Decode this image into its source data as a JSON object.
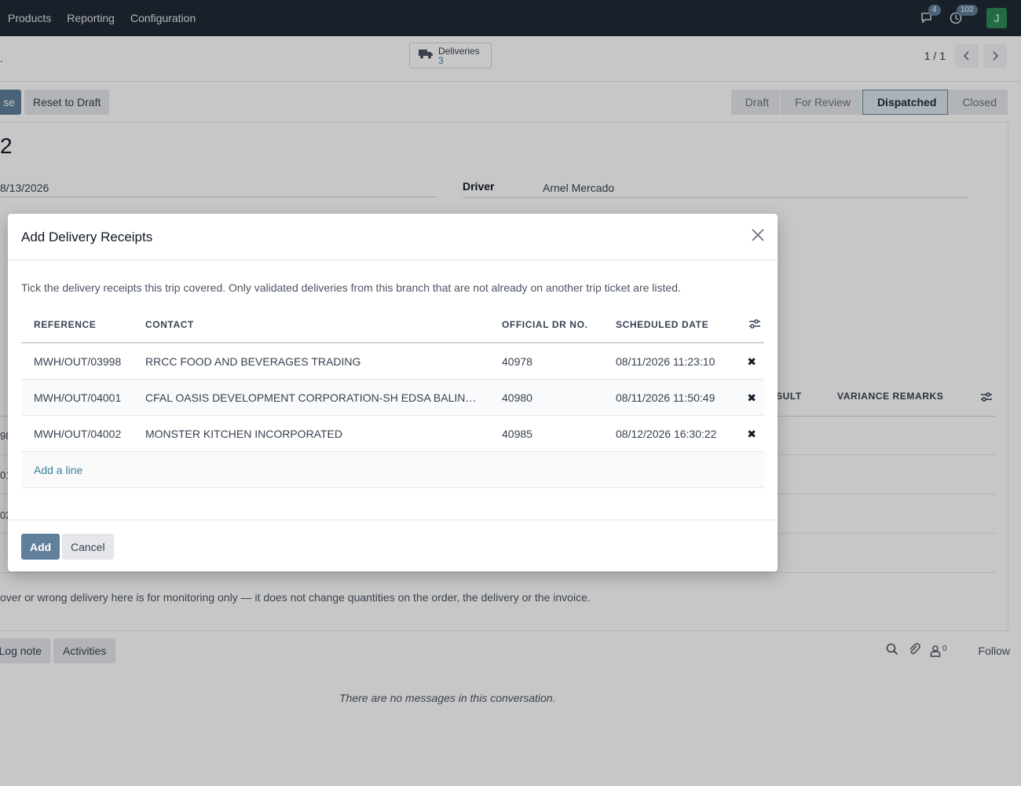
{
  "navbar": {
    "menu": [
      "Products",
      "Reporting",
      "Configuration"
    ],
    "messages_count": "4",
    "activities_count": "102",
    "avatar_initial": "J"
  },
  "control": {
    "smart_button": {
      "label": "Deliveries",
      "count": "3",
      "icon": "truck-icon"
    },
    "pager_value": "1 / 1"
  },
  "statusbar": {
    "close_label": "se",
    "reset_label": "Reset to Draft",
    "stages": [
      "Draft",
      "For Review",
      "Dispatched",
      "Closed"
    ],
    "active_stage": "Dispatched"
  },
  "form": {
    "title": "2",
    "date_value": "8/13/2026",
    "driver_label": "Driver",
    "driver_value": "Arnel Mercado",
    "background_columns": [
      "SULT",
      "VARIANCE REMARKS"
    ],
    "background_row_fragments": [
      "98",
      "01",
      "02"
    ],
    "help_text": "over or wrong delivery here is for monitoring only — it does not change quantities on the order, the delivery or the invoice."
  },
  "chatter": {
    "log_note": "Log note",
    "activities": "Activities",
    "followers_count": "0",
    "follow": "Follow",
    "empty_message": "There are no messages in this conversation."
  },
  "dialog": {
    "title": "Add Delivery Receipts",
    "description": "Tick the delivery receipts this trip covered. Only validated deliveries from this branch that are not already on another trip ticket are listed.",
    "columns": {
      "reference": "REFERENCE",
      "contact": "CONTACT",
      "official_dr": "OFFICIAL DR NO.",
      "scheduled_date": "SCHEDULED DATE"
    },
    "rows": [
      {
        "reference": "MWH/OUT/03998",
        "contact": "RRCC FOOD AND BEVERAGES TRADING",
        "official_dr": "40978",
        "scheduled_date": "08/11/2026 11:23:10"
      },
      {
        "reference": "MWH/OUT/04001",
        "contact": "CFAL OASIS DEVELOPMENT CORPORATION-SH EDSA BALINTAWAK",
        "official_dr": "40980",
        "scheduled_date": "08/11/2026 11:50:49"
      },
      {
        "reference": "MWH/OUT/04002",
        "contact": "MONSTER KITCHEN INCORPORATED",
        "official_dr": "40985",
        "scheduled_date": "08/12/2026 16:30:22"
      }
    ],
    "add_line": "Add a line",
    "add_button": "Add",
    "cancel_button": "Cancel"
  },
  "colors": {
    "primary": "#5f7f9a",
    "navbar": "#1f2937",
    "link": "#3b7ea1"
  }
}
